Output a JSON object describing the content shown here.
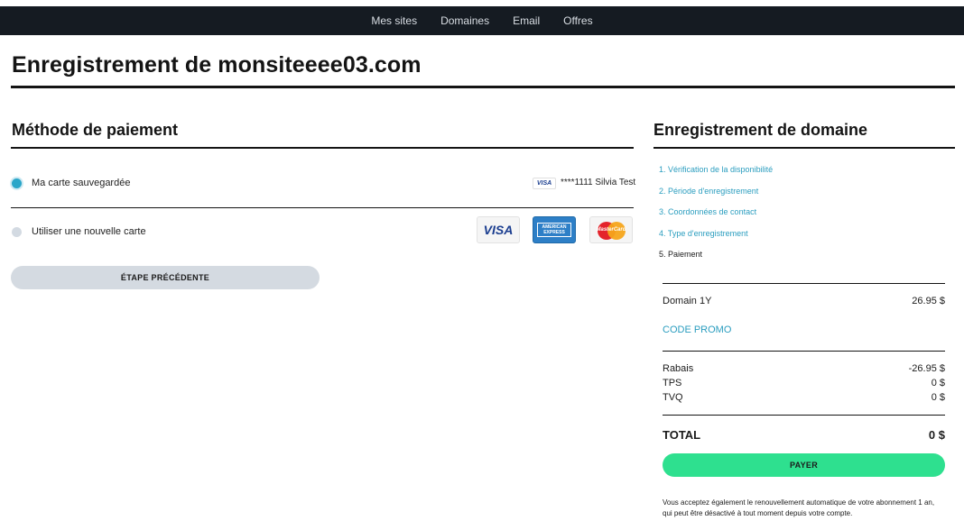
{
  "nav": {
    "items": [
      "Mes sites",
      "Domaines",
      "Email",
      "Offres"
    ]
  },
  "page": {
    "title": "Enregistrement de monsiteeee03.com"
  },
  "payment": {
    "title": "Méthode de paiement",
    "saved_card_label": "Ma carte sauvegardée",
    "saved_card_brand": "VISA",
    "saved_card_text": "****1111 Silvia Test",
    "new_card_label": "Utiliser une nouvelle carte",
    "logos": {
      "visa": "VISA",
      "amex_line1": "AMERICAN",
      "amex_line2": "EXPRESS",
      "mastercard": "MasterCard"
    },
    "prev_button": "ÉTAPE PRÉCÉDENTE"
  },
  "sidebar": {
    "title": "Enregistrement de domaine",
    "steps": [
      "1. Vérification de la disponibilité",
      "2. Période d'enregistrement",
      "3. Coordonnées de contact",
      "4. Type d'enregistrement",
      "5. Paiement"
    ],
    "domain_label": "Domain 1Y",
    "domain_price": "26.95 $",
    "promo_label": "CODE PROMO",
    "rabais_label": "Rabais",
    "rabais_value": "-26.95 $",
    "tps_label": "TPS",
    "tps_value": "0 $",
    "tvq_label": "TVQ",
    "tvq_value": "0 $",
    "total_label": "TOTAL",
    "total_value": "0 $",
    "pay_button": "PAYER",
    "legal": "Vous acceptez également le renouvellement automatique de votre abonnement 1 an, qui peut être désactivé à tout moment depuis votre compte."
  },
  "colors": {
    "accent": "#2a9dbf",
    "pay": "#2ee08f",
    "nav_bg": "#151b22",
    "secondary_btn": "#d4dae1"
  }
}
